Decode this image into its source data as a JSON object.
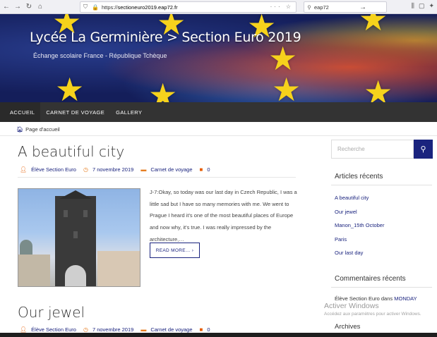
{
  "browser": {
    "url_prefix": "https://",
    "url_host": "sectioneuro2019.eap72.fr",
    "search_query": "eap72"
  },
  "site": {
    "title": "Lycée La Germinière > Section Euro 2019",
    "subtitle": "Échange scolaire France - République Tchèque",
    "nav": [
      "ACCUEIL",
      "CARNET DE VOYAGE",
      "GALLERY"
    ],
    "breadcrumb": "Page d'accueil"
  },
  "posts": [
    {
      "title": "A beautiful city",
      "author": "Élève Section Euro",
      "date": "7 novembre 2019",
      "category": "Carnet de voyage",
      "comments": "0",
      "excerpt": "J-7:Okay, so today was our last day in Czech Republic, I was a little sad but I have so many memories with me. We went to Prague I heard it's one of the most beautiful places of Europe and now why, it's true. I was really impressed by the architecture,…",
      "read_more": "READ MORE… ›"
    },
    {
      "title": "Our jewel",
      "author": "Élève Section Euro",
      "date": "7 novembre 2019",
      "category": "Carnet de voyage",
      "comments": "0"
    }
  ],
  "sidebar": {
    "search_placeholder": "Recherche",
    "recent_posts_title": "Articles récents",
    "recent_posts": [
      "A beautiful city",
      "Our jewel",
      "Manon_15th October",
      "Paris",
      "Our last day"
    ],
    "recent_comments_title": "Commentaires récents",
    "comment_author": "Élève Section Euro",
    "comment_connector": " dans ",
    "comment_post": "MONDAY",
    "archives_title": "Archives"
  },
  "watermark": {
    "title": "Activer Windows",
    "subtitle": "Accédez aux paramètres pour activer Windows."
  },
  "colors": {
    "accent": "#1a237e",
    "nav_bg": "#333333",
    "meta_icon": "#e65c00"
  }
}
